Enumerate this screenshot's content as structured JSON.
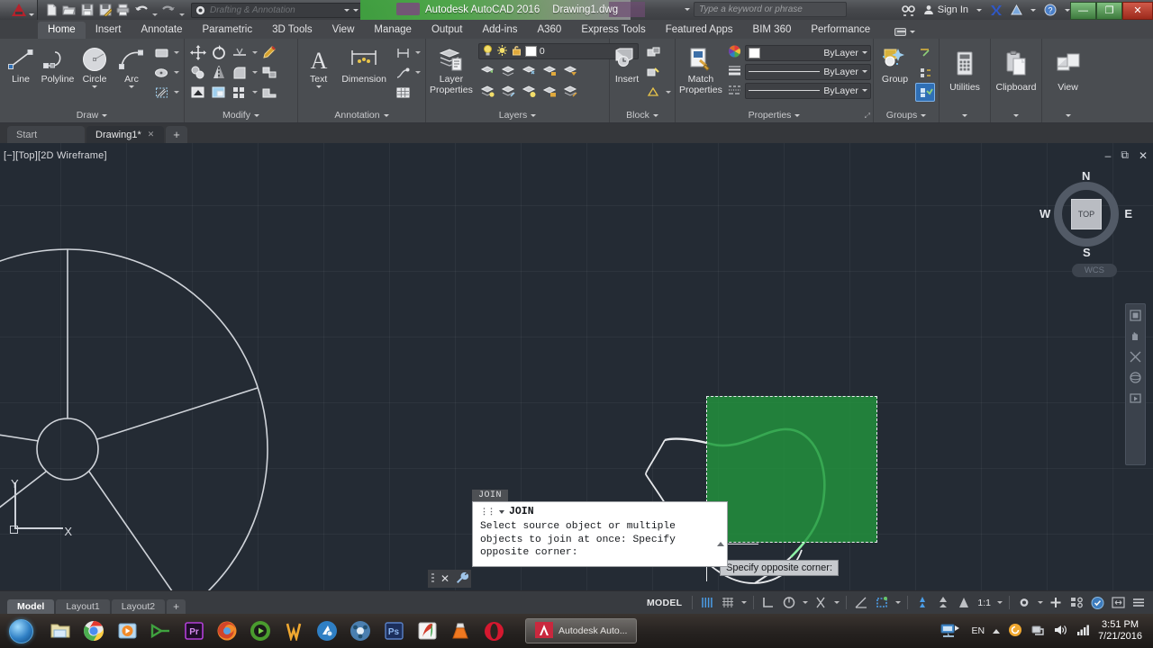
{
  "titlebar": {
    "app_title": "Autodesk AutoCAD 2016",
    "document_title": "Drawing1.dwg",
    "workspace": "Drafting & Annotation",
    "search_placeholder": "Type a keyword or phrase",
    "sign_in": "Sign In",
    "quick_access": [
      {
        "name": "new-file",
        "icon": "new-document-icon"
      },
      {
        "name": "open-file",
        "icon": "open-folder-icon"
      },
      {
        "name": "save-file",
        "icon": "save-disk-icon"
      },
      {
        "name": "save-as",
        "icon": "save-as-icon"
      },
      {
        "name": "plot",
        "icon": "printer-icon"
      },
      {
        "name": "undo",
        "icon": "undo-arrow-icon"
      },
      {
        "name": "redo",
        "icon": "redo-arrow-icon"
      }
    ],
    "window_buttons": {
      "minimize": "—",
      "maximize": "❐",
      "close": "✕"
    }
  },
  "ribbon": {
    "tabs": [
      {
        "label": "Home",
        "active": true
      },
      {
        "label": "Insert",
        "active": false
      },
      {
        "label": "Annotate",
        "active": false
      },
      {
        "label": "Parametric",
        "active": false
      },
      {
        "label": "3D Tools",
        "active": false
      },
      {
        "label": "View",
        "active": false
      },
      {
        "label": "Manage",
        "active": false
      },
      {
        "label": "Output",
        "active": false
      },
      {
        "label": "Add-ins",
        "active": false
      },
      {
        "label": "A360",
        "active": false
      },
      {
        "label": "Express Tools",
        "active": false
      },
      {
        "label": "Featured Apps",
        "active": false
      },
      {
        "label": "BIM 360",
        "active": false
      },
      {
        "label": "Performance",
        "active": false
      }
    ],
    "panels": {
      "draw": {
        "title": "Draw",
        "buttons": [
          {
            "label": "Line",
            "icon": "line-icon"
          },
          {
            "label": "Polyline",
            "icon": "polyline-icon"
          },
          {
            "label": "Circle",
            "icon": "circle-icon"
          },
          {
            "label": "Arc",
            "icon": "arc-icon"
          }
        ],
        "small_tools": [
          "rectangle-icon",
          "ellipse-icon",
          "hatch-icon"
        ]
      },
      "modify": {
        "title": "Modify",
        "small_tools": [
          "move-icon",
          "rotate-icon",
          "trim-icon",
          "erase-icon",
          "copy-icon",
          "mirror-icon",
          "fillet-icon",
          "explode-icon",
          "stretch-icon",
          "scale-icon",
          "array-icon",
          "offset-icon"
        ]
      },
      "annotation": {
        "title": "Annotation",
        "buttons": [
          {
            "label": "Text",
            "icon": "text-a-icon"
          },
          {
            "label": "Dimension",
            "icon": "dimension-icon"
          }
        ],
        "small_tools": [
          "linear-dim-icon",
          "leader-icon",
          "table-icon"
        ]
      },
      "layers": {
        "title": "Layers",
        "button": {
          "label": "Layer\nProperties",
          "label_line1": "Layer",
          "label_line2": "Properties",
          "icon": "layer-properties-icon"
        },
        "current_layer": "0",
        "layer_state_icons": [
          "lightbulb-icon",
          "sun-icon",
          "unlock-icon"
        ],
        "small_tools": [
          "layer-isolate-icon",
          "layer-unisolate-icon",
          "layer-freeze-icon",
          "layer-lock-icon",
          "layer-merge-icon",
          "layer-on-icon",
          "layer-off-icon",
          "layer-thaw-icon",
          "layer-unlock-icon",
          "layer-delete-icon"
        ]
      },
      "block": {
        "title": "Block",
        "button": {
          "label": "Insert",
          "icon": "insert-block-icon"
        },
        "small_tools": [
          "create-block-icon",
          "edit-block-icon",
          "define-attribute-icon"
        ]
      },
      "properties": {
        "title": "Properties",
        "button": {
          "label_line1": "Match",
          "label_line2": "Properties",
          "icon": "match-properties-icon"
        },
        "color": "ByLayer",
        "lineweight": "ByLayer",
        "linetype": "ByLayer",
        "side_icons": [
          "color-wheel-icon",
          "lineweight-icon",
          "linetype-icon"
        ]
      },
      "groups": {
        "title": "Groups",
        "button": {
          "label": "Group",
          "icon": "group-icon"
        },
        "small_tools": [
          "ungroup-icon",
          "group-edit-icon",
          "group-selection-on-icon"
        ]
      },
      "utilities": {
        "title": "Utilities",
        "label": "Utilities",
        "icon": "calculator-icon"
      },
      "clipboard": {
        "title": "Clipboard",
        "label": "Clipboard",
        "icon": "clipboard-icon"
      },
      "view_panel": {
        "title": "View",
        "label": "View",
        "icon": "view-window-icon"
      }
    }
  },
  "doc_tabs": [
    {
      "label": "Start",
      "active": false,
      "closable": false
    },
    {
      "label": "Drawing1*",
      "active": true,
      "closable": true
    },
    {
      "label": "+",
      "active": false,
      "closable": false
    }
  ],
  "canvas": {
    "viewport_label": "[−][Top][2D Wireframe]",
    "viewcube": {
      "face": "TOP",
      "north": "N",
      "south": "S",
      "east": "E",
      "west": "W"
    },
    "wcs_button": "WCS",
    "ucs": {
      "x_label": "X",
      "y_label": "Y"
    },
    "tooltip": "Specify opposite corner:",
    "selection_color": "#22963d",
    "object_color": "#e8eaec",
    "highlight_color": "#7ef09a",
    "navbar_icons": [
      "steering-wheel-icon",
      "pan-icon",
      "zoom-extents-icon",
      "orbit-icon",
      "showmotion-icon"
    ]
  },
  "command_line": {
    "tag": "JOIN",
    "prompt_command": "JOIN",
    "text": "Select source object or multiple objects to join at once: Specify opposite corner:",
    "close_icon": "close-icon",
    "settings_icon": "wrench-icon"
  },
  "status_bar": {
    "layout_tabs": [
      {
        "label": "Model",
        "active": true
      },
      {
        "label": "Layout1",
        "active": false
      },
      {
        "label": "Layout2",
        "active": false
      },
      {
        "label": "+",
        "active": false
      }
    ],
    "model_button": "MODEL",
    "annotation_scale": "1:1",
    "icons": [
      {
        "name": "grid-display-icon",
        "on": true
      },
      {
        "name": "snap-mode-icon",
        "on": false
      },
      {
        "name": "ortho-mode-icon",
        "on": false
      },
      {
        "name": "polar-tracking-icon",
        "on": false
      },
      {
        "name": "object-snap-icon",
        "on": false
      },
      {
        "name": "object-snap-tracking-icon",
        "on": false
      },
      {
        "name": "annotation-visibility-icon",
        "on": true
      },
      {
        "name": "autoscale-icon",
        "on": false
      },
      {
        "name": "annotation-scale-icon",
        "on": false
      },
      {
        "name": "workspace-switching-icon",
        "on": false
      },
      {
        "name": "hardware-acceleration-icon",
        "on": false
      },
      {
        "name": "isolate-objects-icon",
        "on": false
      },
      {
        "name": "clean-screen-icon",
        "on": false
      },
      {
        "name": "customization-icon",
        "on": false
      }
    ]
  },
  "taskbar": {
    "start_label": "Start",
    "pinned": [
      {
        "name": "file-explorer-icon"
      },
      {
        "name": "google-chrome-icon"
      },
      {
        "name": "media-player-icon"
      },
      {
        "name": "camtasia-icon"
      },
      {
        "name": "adobe-premiere-icon"
      },
      {
        "name": "mozilla-firefox-icon"
      },
      {
        "name": "gom-player-icon"
      },
      {
        "name": "wondershare-icon"
      },
      {
        "name": "sketchup-icon"
      },
      {
        "name": "video-converter-icon"
      },
      {
        "name": "adobe-photoshop-icon"
      },
      {
        "name": "pdf-reader-icon"
      },
      {
        "name": "vlc-player-icon"
      },
      {
        "name": "opera-browser-icon"
      }
    ],
    "active_window": "Autodesk Auto...",
    "tray": {
      "language": "EN",
      "network_icon": "network-icon",
      "volume_icon": "volume-icon",
      "signal_icon": "signal-bars-icon",
      "action_center_icon": "action-center-icon",
      "time": "3:51 PM",
      "date": "7/21/2016"
    }
  }
}
